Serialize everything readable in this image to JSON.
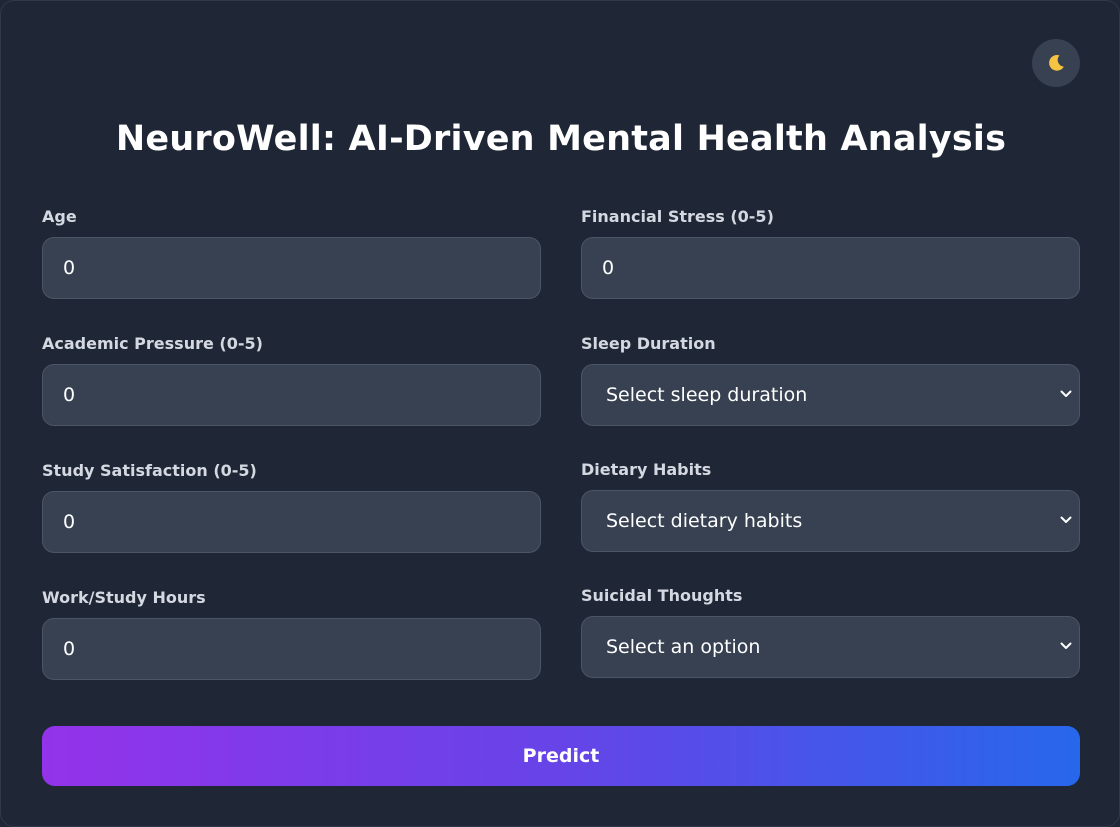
{
  "header": {
    "title": "NeuroWell: AI-Driven Mental Health Analysis",
    "theme_toggle_icon": "moon-icon"
  },
  "form": {
    "age": {
      "label": "Age",
      "value": "0"
    },
    "financial_stress": {
      "label": "Financial Stress (0-5)",
      "value": "0"
    },
    "academic_pressure": {
      "label": "Academic Pressure (0-5)",
      "value": "0"
    },
    "sleep_duration": {
      "label": "Sleep Duration",
      "selected": "Select sleep duration"
    },
    "study_satisfaction": {
      "label": "Study Satisfaction (0-5)",
      "value": "0"
    },
    "dietary_habits": {
      "label": "Dietary Habits",
      "selected": "Select dietary habits"
    },
    "work_study_hours": {
      "label": "Work/Study Hours",
      "value": "0"
    },
    "suicidal_thoughts": {
      "label": "Suicidal Thoughts",
      "selected": "Select an option"
    }
  },
  "actions": {
    "predict_label": "Predict"
  },
  "colors": {
    "background": "#1f2737",
    "input_bg": "#374151",
    "gradient_start": "#9333ea",
    "gradient_end": "#2767eb",
    "moon": "#f5c542"
  }
}
